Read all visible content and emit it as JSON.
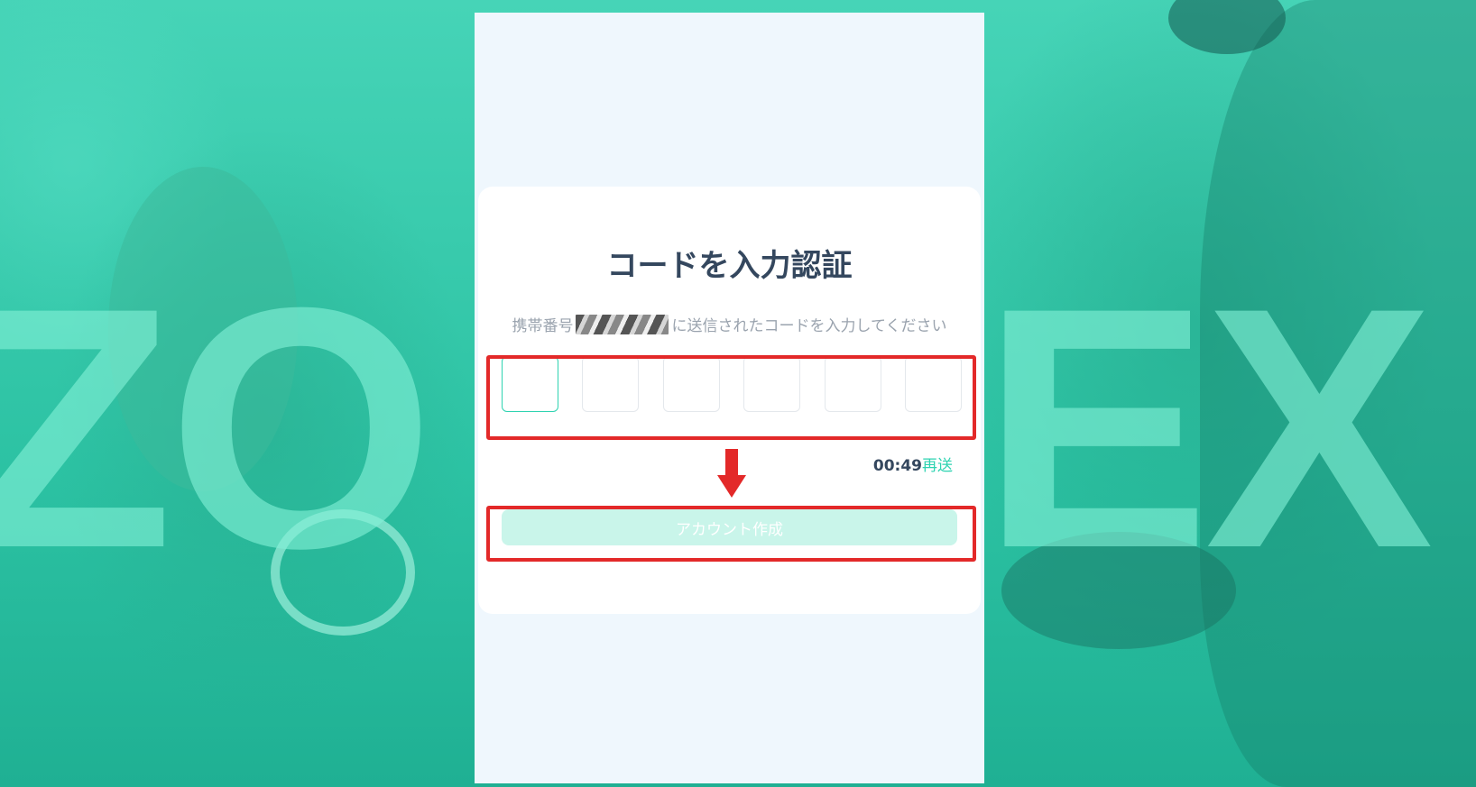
{
  "background": {
    "letters_left": "ZO",
    "letters_right": "EX"
  },
  "verify": {
    "title": "コードを入力認証",
    "subtitle_prefix": "携帯番号",
    "subtitle_suffix": "に送信されたコードを入力してください",
    "code_boxes": [
      "",
      "",
      "",
      "",
      "",
      ""
    ],
    "timer": "00:49",
    "resend_label": "再送",
    "create_account_label": "アカウント作成"
  },
  "colors": {
    "accent": "#2ed3b1",
    "title": "#34475e",
    "button_disabled": "#c9f5ea",
    "annotation": "#e32929"
  },
  "icons": {
    "annotation_arrow": "arrow-down-icon"
  }
}
